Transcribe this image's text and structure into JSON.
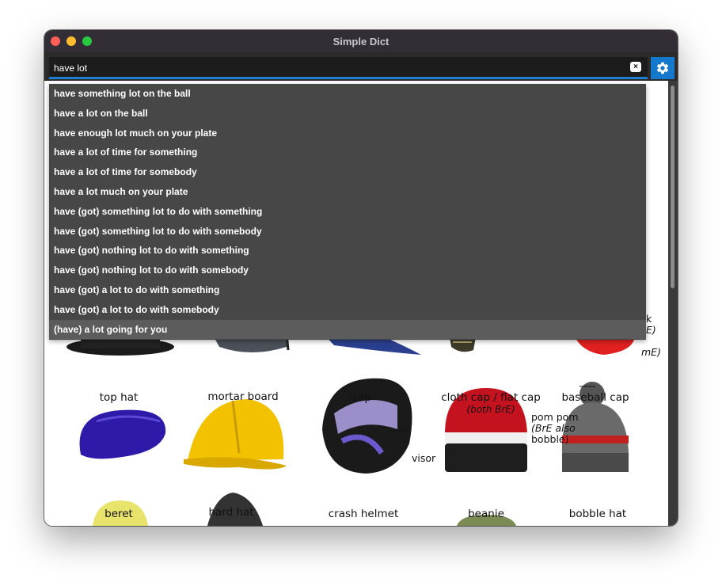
{
  "window": {
    "title": "Simple Dict"
  },
  "search": {
    "value": "have lot",
    "clear_label": "×"
  },
  "suggestions": [
    "have something lot on the ball",
    "have a lot on the ball",
    "have enough lot much on your plate",
    "have a lot of time for something",
    "have a lot of time for somebody",
    "have a lot much on your plate",
    "have (got) something lot to do with something",
    "have (got) something lot to do with somebody",
    "have (got) nothing lot to do with something",
    "have (got) nothing lot to do with somebody",
    "have (got) a lot to do with something",
    "have (got) a lot to do with somebody",
    "(have) a lot going for you"
  ],
  "highlighted_suggestion": 12,
  "illustration": {
    "captions": {
      "top_hat": "top hat",
      "mortar_board": "mortar board",
      "cap": "cap",
      "cloth_cap": "cloth cap / flat cap",
      "cloth_cap_note": "(both BrE)",
      "baseball_cap": "baseball cap",
      "beret": "beret",
      "hard_hat": "hard hat",
      "crash_helmet": "crash helmet",
      "beanie": "beanie",
      "bobble_hat": "bobble hat",
      "visor": "visor",
      "pom_pom": "pom pom",
      "pom_pom_note_1": "(BrE also",
      "pom_pom_note_2": "bobble)",
      "partial_1": "k",
      "partial_2": "E)",
      "partial_3": "mE)"
    }
  },
  "colors": {
    "accent": "#1479cc",
    "dropdown_bg": "#474747",
    "titlebar_bg": "#332e36"
  }
}
